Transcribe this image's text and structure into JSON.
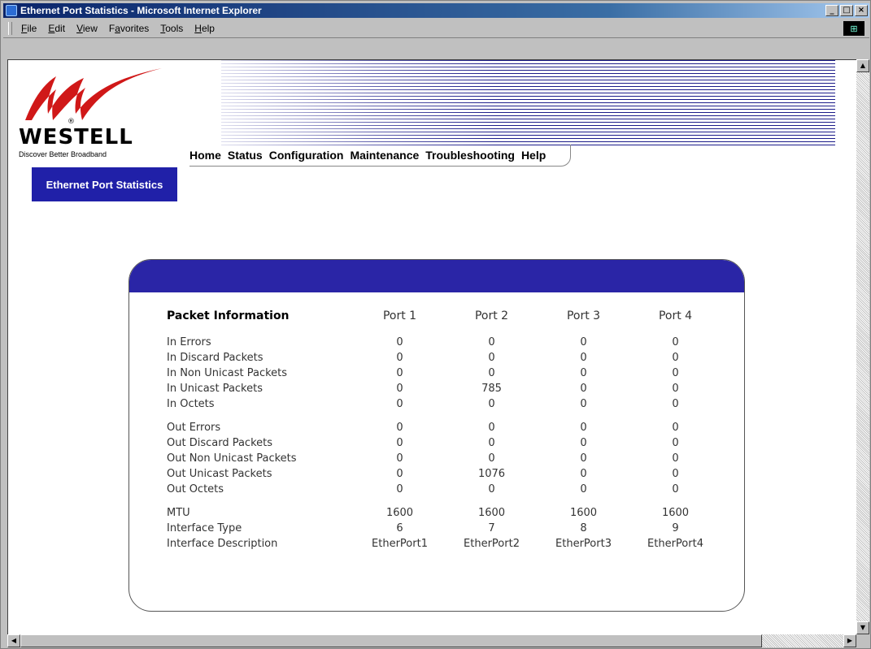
{
  "window": {
    "title": "Ethernet Port Statistics - Microsoft Internet Explorer",
    "buttons": [
      "_",
      "□",
      "×"
    ]
  },
  "menu": [
    {
      "label": "File",
      "underline": "F",
      "rest": "ile"
    },
    {
      "label": "Edit",
      "underline": "E",
      "rest": "dit"
    },
    {
      "label": "View",
      "underline": "V",
      "rest": "iew"
    },
    {
      "label": "Favorites",
      "underline": "a",
      "pre": "F",
      "rest": "vorites"
    },
    {
      "label": "Tools",
      "underline": "T",
      "rest": "ools"
    },
    {
      "label": "Help",
      "underline": "H",
      "rest": "elp"
    }
  ],
  "logo": {
    "name": "WESTELL",
    "tagline": "Discover  Better  Broadband",
    "mark": "®"
  },
  "nav": [
    "Home",
    "Status",
    "Configuration",
    "Maintenance",
    "Troubleshooting",
    "Help"
  ],
  "section_label": "Ethernet Port Statistics",
  "table": {
    "header": [
      "Packet Information",
      "Port 1",
      "Port 2",
      "Port 3",
      "Port 4"
    ],
    "groups": [
      [
        [
          "In Errors",
          "0",
          "0",
          "0",
          "0"
        ],
        [
          "In Discard Packets",
          "0",
          "0",
          "0",
          "0"
        ],
        [
          "In Non Unicast Packets",
          "0",
          "0",
          "0",
          "0"
        ],
        [
          "In Unicast Packets",
          "0",
          "785",
          "0",
          "0"
        ],
        [
          "In Octets",
          "0",
          "0",
          "0",
          "0"
        ]
      ],
      [
        [
          "Out Errors",
          "0",
          "0",
          "0",
          "0"
        ],
        [
          "Out Discard Packets",
          "0",
          "0",
          "0",
          "0"
        ],
        [
          "Out Non Unicast Packets",
          "0",
          "0",
          "0",
          "0"
        ],
        [
          "Out Unicast Packets",
          "0",
          "1076",
          "0",
          "0"
        ],
        [
          "Out Octets",
          "0",
          "0",
          "0",
          "0"
        ]
      ],
      [
        [
          "MTU",
          "1600",
          "1600",
          "1600",
          "1600"
        ],
        [
          "Interface Type",
          "6",
          "7",
          "8",
          "9"
        ],
        [
          "Interface Description",
          "EtherPort1",
          "EtherPort2",
          "EtherPort3",
          "EtherPort4"
        ]
      ]
    ]
  },
  "colors": {
    "accent": "#2a25a6",
    "logo_red": "#d01818"
  }
}
